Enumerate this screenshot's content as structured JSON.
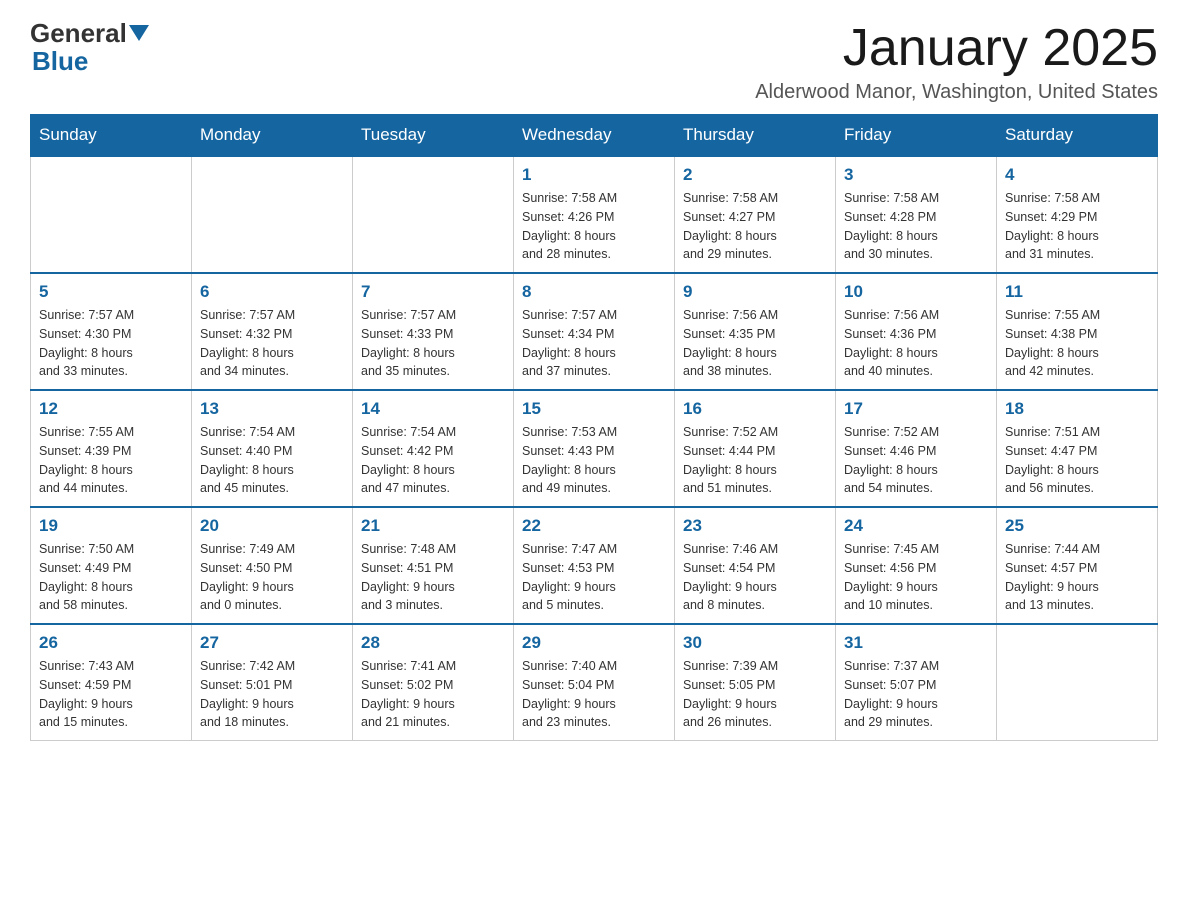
{
  "header": {
    "logo_general": "General",
    "logo_blue": "Blue",
    "month": "January 2025",
    "location": "Alderwood Manor, Washington, United States"
  },
  "days_of_week": [
    "Sunday",
    "Monday",
    "Tuesday",
    "Wednesday",
    "Thursday",
    "Friday",
    "Saturday"
  ],
  "weeks": [
    [
      {
        "day": "",
        "info": ""
      },
      {
        "day": "",
        "info": ""
      },
      {
        "day": "",
        "info": ""
      },
      {
        "day": "1",
        "info": "Sunrise: 7:58 AM\nSunset: 4:26 PM\nDaylight: 8 hours\nand 28 minutes."
      },
      {
        "day": "2",
        "info": "Sunrise: 7:58 AM\nSunset: 4:27 PM\nDaylight: 8 hours\nand 29 minutes."
      },
      {
        "day": "3",
        "info": "Sunrise: 7:58 AM\nSunset: 4:28 PM\nDaylight: 8 hours\nand 30 minutes."
      },
      {
        "day": "4",
        "info": "Sunrise: 7:58 AM\nSunset: 4:29 PM\nDaylight: 8 hours\nand 31 minutes."
      }
    ],
    [
      {
        "day": "5",
        "info": "Sunrise: 7:57 AM\nSunset: 4:30 PM\nDaylight: 8 hours\nand 33 minutes."
      },
      {
        "day": "6",
        "info": "Sunrise: 7:57 AM\nSunset: 4:32 PM\nDaylight: 8 hours\nand 34 minutes."
      },
      {
        "day": "7",
        "info": "Sunrise: 7:57 AM\nSunset: 4:33 PM\nDaylight: 8 hours\nand 35 minutes."
      },
      {
        "day": "8",
        "info": "Sunrise: 7:57 AM\nSunset: 4:34 PM\nDaylight: 8 hours\nand 37 minutes."
      },
      {
        "day": "9",
        "info": "Sunrise: 7:56 AM\nSunset: 4:35 PM\nDaylight: 8 hours\nand 38 minutes."
      },
      {
        "day": "10",
        "info": "Sunrise: 7:56 AM\nSunset: 4:36 PM\nDaylight: 8 hours\nand 40 minutes."
      },
      {
        "day": "11",
        "info": "Sunrise: 7:55 AM\nSunset: 4:38 PM\nDaylight: 8 hours\nand 42 minutes."
      }
    ],
    [
      {
        "day": "12",
        "info": "Sunrise: 7:55 AM\nSunset: 4:39 PM\nDaylight: 8 hours\nand 44 minutes."
      },
      {
        "day": "13",
        "info": "Sunrise: 7:54 AM\nSunset: 4:40 PM\nDaylight: 8 hours\nand 45 minutes."
      },
      {
        "day": "14",
        "info": "Sunrise: 7:54 AM\nSunset: 4:42 PM\nDaylight: 8 hours\nand 47 minutes."
      },
      {
        "day": "15",
        "info": "Sunrise: 7:53 AM\nSunset: 4:43 PM\nDaylight: 8 hours\nand 49 minutes."
      },
      {
        "day": "16",
        "info": "Sunrise: 7:52 AM\nSunset: 4:44 PM\nDaylight: 8 hours\nand 51 minutes."
      },
      {
        "day": "17",
        "info": "Sunrise: 7:52 AM\nSunset: 4:46 PM\nDaylight: 8 hours\nand 54 minutes."
      },
      {
        "day": "18",
        "info": "Sunrise: 7:51 AM\nSunset: 4:47 PM\nDaylight: 8 hours\nand 56 minutes."
      }
    ],
    [
      {
        "day": "19",
        "info": "Sunrise: 7:50 AM\nSunset: 4:49 PM\nDaylight: 8 hours\nand 58 minutes."
      },
      {
        "day": "20",
        "info": "Sunrise: 7:49 AM\nSunset: 4:50 PM\nDaylight: 9 hours\nand 0 minutes."
      },
      {
        "day": "21",
        "info": "Sunrise: 7:48 AM\nSunset: 4:51 PM\nDaylight: 9 hours\nand 3 minutes."
      },
      {
        "day": "22",
        "info": "Sunrise: 7:47 AM\nSunset: 4:53 PM\nDaylight: 9 hours\nand 5 minutes."
      },
      {
        "day": "23",
        "info": "Sunrise: 7:46 AM\nSunset: 4:54 PM\nDaylight: 9 hours\nand 8 minutes."
      },
      {
        "day": "24",
        "info": "Sunrise: 7:45 AM\nSunset: 4:56 PM\nDaylight: 9 hours\nand 10 minutes."
      },
      {
        "day": "25",
        "info": "Sunrise: 7:44 AM\nSunset: 4:57 PM\nDaylight: 9 hours\nand 13 minutes."
      }
    ],
    [
      {
        "day": "26",
        "info": "Sunrise: 7:43 AM\nSunset: 4:59 PM\nDaylight: 9 hours\nand 15 minutes."
      },
      {
        "day": "27",
        "info": "Sunrise: 7:42 AM\nSunset: 5:01 PM\nDaylight: 9 hours\nand 18 minutes."
      },
      {
        "day": "28",
        "info": "Sunrise: 7:41 AM\nSunset: 5:02 PM\nDaylight: 9 hours\nand 21 minutes."
      },
      {
        "day": "29",
        "info": "Sunrise: 7:40 AM\nSunset: 5:04 PM\nDaylight: 9 hours\nand 23 minutes."
      },
      {
        "day": "30",
        "info": "Sunrise: 7:39 AM\nSunset: 5:05 PM\nDaylight: 9 hours\nand 26 minutes."
      },
      {
        "day": "31",
        "info": "Sunrise: 7:37 AM\nSunset: 5:07 PM\nDaylight: 9 hours\nand 29 minutes."
      },
      {
        "day": "",
        "info": ""
      }
    ]
  ]
}
